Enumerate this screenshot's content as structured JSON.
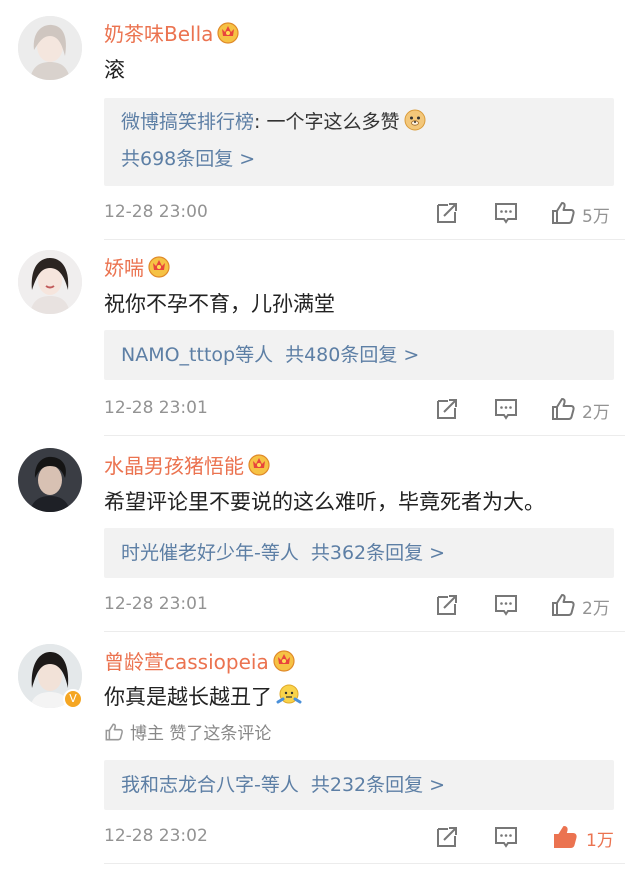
{
  "comments": [
    {
      "username": "奶茶味Bella",
      "text": "滚",
      "reply_preview": {
        "author": "微博搞笑排行榜",
        "separator": ": ",
        "text": "一个字这么多赞",
        "emoji": "doge-emoji"
      },
      "reply_count_label": "共698条回复 >",
      "time": "12-28 23:00",
      "likes": "5万",
      "liked": false
    },
    {
      "username": "娇喘",
      "text": "祝你不孕不育，儿孙满堂",
      "reply_users": "NAMO_tttop等人",
      "reply_count_label": "共480条回复 >",
      "time": "12-28 23:01",
      "likes": "2万",
      "liked": false
    },
    {
      "username": "水晶男孩猪悟能",
      "text": "希望评论里不要说的这么难听，毕竟死者为大。",
      "reply_users": "时光催老好少年-等人",
      "reply_count_label": "共362条回复 >",
      "time": "12-28 23:01",
      "likes": "2万",
      "liked": false
    },
    {
      "username": "曾龄萱cassiopeia",
      "text": "你真是越长越丑了",
      "emoji": "shrug-emoji",
      "verified": "V",
      "liked_by": "博主 赞了这条评论",
      "reply_users": "我和志龙合八字-等人",
      "reply_count_label": "共232条回复 >",
      "time": "12-28 23:02",
      "likes": "1万",
      "liked": true
    }
  ],
  "colors": {
    "username": "#eb7350",
    "link": "#5d7fa5",
    "meta": "#939393",
    "reply_bg": "#f2f2f2",
    "like_active": "#eb7350"
  },
  "icons": {
    "repost": "repost-icon",
    "comment": "comment-icon",
    "like": "thumbs-up-icon",
    "badge": "crown-badge-icon"
  }
}
